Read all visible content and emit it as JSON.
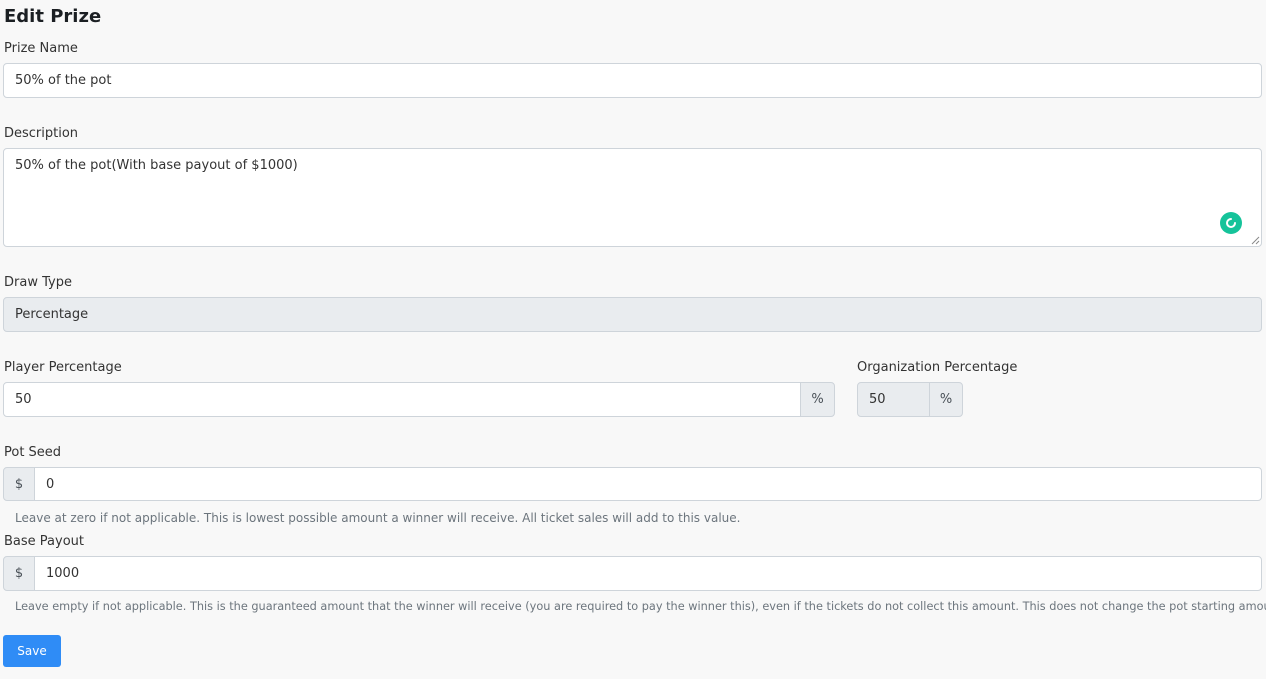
{
  "page_title": "Edit Prize",
  "prize_name": {
    "label": "Prize Name",
    "value": "50% of the pot"
  },
  "description": {
    "label": "Description",
    "value": "50% of the pot(With base payout of $1000)"
  },
  "draw_type": {
    "label": "Draw Type",
    "value": "Percentage"
  },
  "player_percentage": {
    "label": "Player Percentage",
    "value": "50",
    "suffix": "%"
  },
  "organization_percentage": {
    "label": "Organization Percentage",
    "value": "50",
    "suffix": "%"
  },
  "pot_seed": {
    "label": "Pot Seed",
    "prefix": "$",
    "value": "0",
    "help": "Leave at zero if not applicable. This is lowest possible amount a winner will receive. All ticket sales will add to this value."
  },
  "base_payout": {
    "label": "Base Payout",
    "prefix": "$",
    "value": "1000",
    "help": "Leave empty if not applicable. This is the guaranteed amount that the winner will receive (you are required to pay the winner this), even if the tickets do not collect this amount. This does not change the pot starting amount."
  },
  "save_label": "Save",
  "colors": {
    "primary": "#2f8cf6",
    "grammarly": "#15c39a",
    "readonly_bg": "#e9ecef"
  },
  "icons": {
    "grammarly": "grammarly-icon",
    "resize": "resize-handle-icon"
  }
}
